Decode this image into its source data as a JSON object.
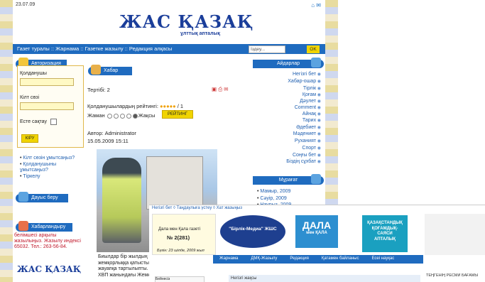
{
  "header": {
    "date": "23.07.09",
    "logo": "ЖАС ҚАЗАҚ",
    "subtitle": "ұлттық апталық",
    "icons": [
      "home-icon",
      "mail-icon"
    ]
  },
  "nav": {
    "items": "Газет туралы :: Жарнама :: Газетке жазылу :: Редакция алқасы",
    "search_placeholder": "Іздеу...",
    "search_button": "OK"
  },
  "auth": {
    "title": "Авторизация",
    "user_label": "Қолданушы",
    "pass_label": "Кілт сөзі",
    "remember_label": "Есте сақтау",
    "login_button": "КІРУ",
    "links": [
      "Кілт сөзін ұмытсаңыз?",
      "Қолданушыны ұмытсаңыз?",
      "Тіркелу"
    ]
  },
  "vote": {
    "title": "Дауыс беру"
  },
  "ads": {
    "title": "Хабарландыру",
    "text": [
      "белімшесі арқылы",
      "жазылыңыз. Жазылу индексі",
      "65032. Тел.: 263-56-84."
    ],
    "logo": "ЖАС ҚАЗАҚ"
  },
  "article": {
    "section": "Хабар",
    "rating_count": "Тертібі: 2",
    "rating_label": "Қолданушылардың рейтингі:",
    "rating_value": "/ 1",
    "scale_bad": "Жаман",
    "scale_good": "Жақсы",
    "rating_button": "РЕЙТИНГ",
    "author": "Автор: Administrator",
    "datetime": "15.05.2009 15:11",
    "snippet": [
      "Биылдар бір жылдың ішінд",
      "жемқорлыққа қатысты іс к",
      "жауапқа тартылыпты. Ал б",
      "ХВП жанындағы Жемқорлы"
    ]
  },
  "right": {
    "menu_title": "Айдарлар",
    "items": [
      "Негізгі бет",
      "Хабар-ошар",
      "Тірлік",
      "Қоғам",
      "Дәулет",
      "Comment",
      "Айнақ",
      "Тарих",
      "Әдебиет",
      "Мәдениет",
      "Руханият",
      "Спорт",
      "Соңғы бет",
      "Біздің сұхбат"
    ],
    "archive_title": "Мұрағат",
    "archive": [
      "Мамыр, 2009",
      "Сәуір, 2009",
      "Наурыз, 2009"
    ]
  },
  "overlay": {
    "crumbs": "Негізгі бет ◊ Таңдаулыға үстеу ◊ Хат жазыңыз",
    "issue_title": "Дала мен Қала газеті",
    "issue_no": "№ 2(281)",
    "issue_date": "Бүгін: 23 шілде, 2009 жыл",
    "logo1": "\"Бірлік-Медиа\" ЖШС",
    "logo2_a": "ДАЛА",
    "logo2_b": "мен ҚАЛА",
    "logo3": [
      "ҚАЗАҚСТАНДЫҚ",
      "ҚОҒАМДЫҚ-",
      "САЯСИ",
      "АПТАЛЫҚ"
    ],
    "menu": [
      "Жарнама",
      "ДМҚ-Жазылу",
      "Редакция",
      "Қатамен байланыс",
      "Есеі науқас"
    ],
    "side": "Бейнесіз",
    "main_heading": "Негізгі жақсы",
    "rate": "ТЕҢГЕНІҢ РЕСМИ БАҒАМЫ"
  },
  "colors": {
    "nav_blue": "#1f6bbf",
    "logo_blue": "#1b3e9a",
    "button_yellow": "#f0d400",
    "ad_red": "#c0182b"
  }
}
